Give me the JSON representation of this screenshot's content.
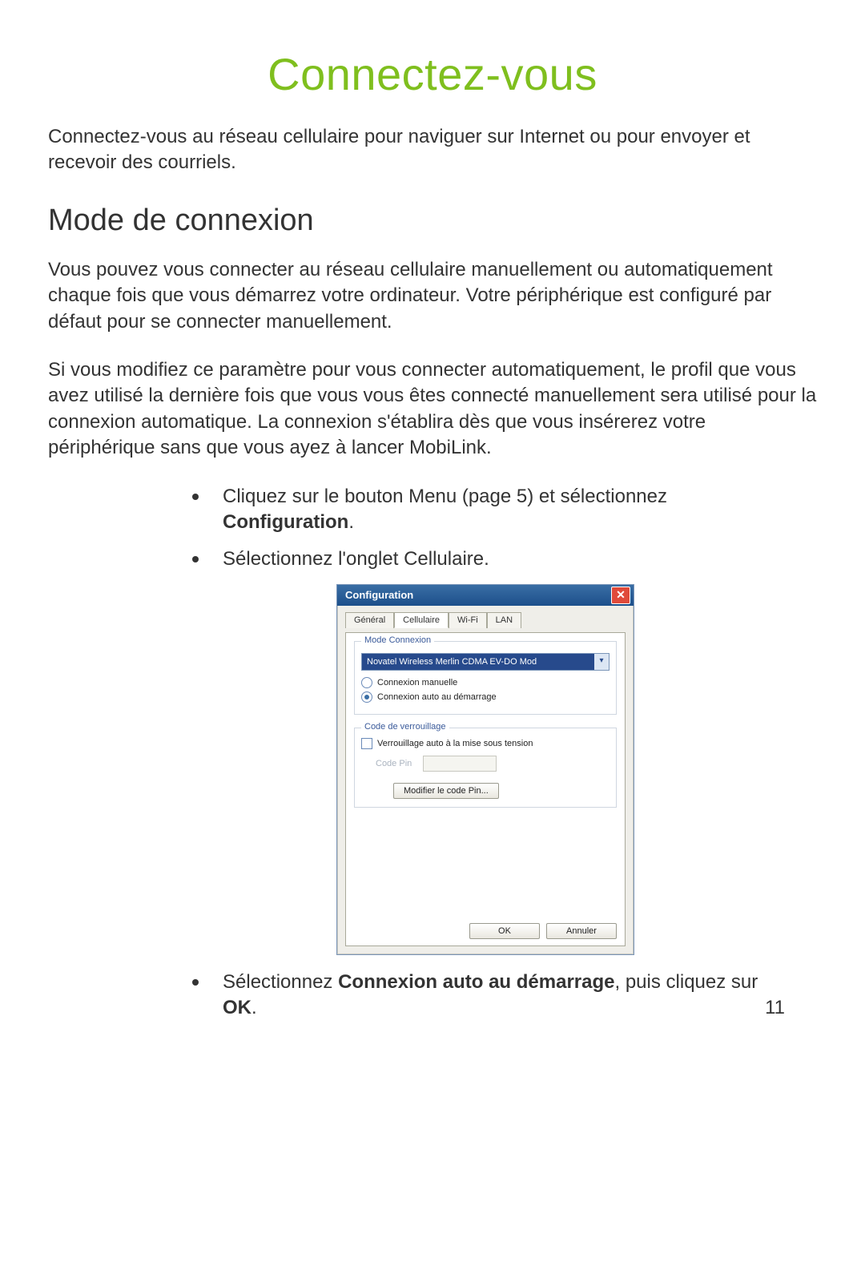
{
  "title": "Connectez-vous",
  "intro": "Connectez-vous au réseau cellulaire pour naviguer sur Internet ou pour envoyer et recevoir des courriels.",
  "section_heading": "Mode de connexion",
  "para1": "Vous pouvez vous connecter au réseau cellulaire manuellement ou automatiquement chaque fois que vous démarrez votre ordinateur. Votre périphérique est configuré par défaut pour se connecter manuellement.",
  "para2": "Si vous modifiez ce paramètre pour vous connecter automatiquement, le profil que vous avez utilisé la dernière fois que vous vous êtes connecté manuellement sera utilisé pour la connexion automatique. La connexion s'établira dès que vous insérerez votre périphérique sans que vous ayez à lancer MobiLink.",
  "bullets": {
    "b1_pre": "Cliquez sur le bouton Menu (page 5) et sélectionnez ",
    "b1_bold": "Configuration",
    "b1_post": ".",
    "b2": "Sélectionnez l'onglet Cellulaire.",
    "b3_pre": "Sélectionnez ",
    "b3_bold1": "Connexion auto au démarrage",
    "b3_mid": ", puis cliquez sur ",
    "b3_bold2": "OK",
    "b3_post": "."
  },
  "page_number": "11",
  "dialog": {
    "title": "Configuration",
    "close": "✕",
    "tabs": {
      "general": "Général",
      "cellulaire": "Cellulaire",
      "wifi": "Wi-Fi",
      "lan": "LAN"
    },
    "group_connection": "Mode Connexion",
    "dropdown_value": "Novatel Wireless Merlin CDMA EV-DO Mod",
    "radio_manual": "Connexion manuelle",
    "radio_auto": "Connexion auto au démarrage",
    "group_lock": "Code de verrouillage",
    "check_autolock": "Verrouillage auto à la mise sous tension",
    "pin_label": "Code Pin",
    "btn_modify_pin": "Modifier le code Pin...",
    "btn_ok": "OK",
    "btn_cancel": "Annuler"
  }
}
